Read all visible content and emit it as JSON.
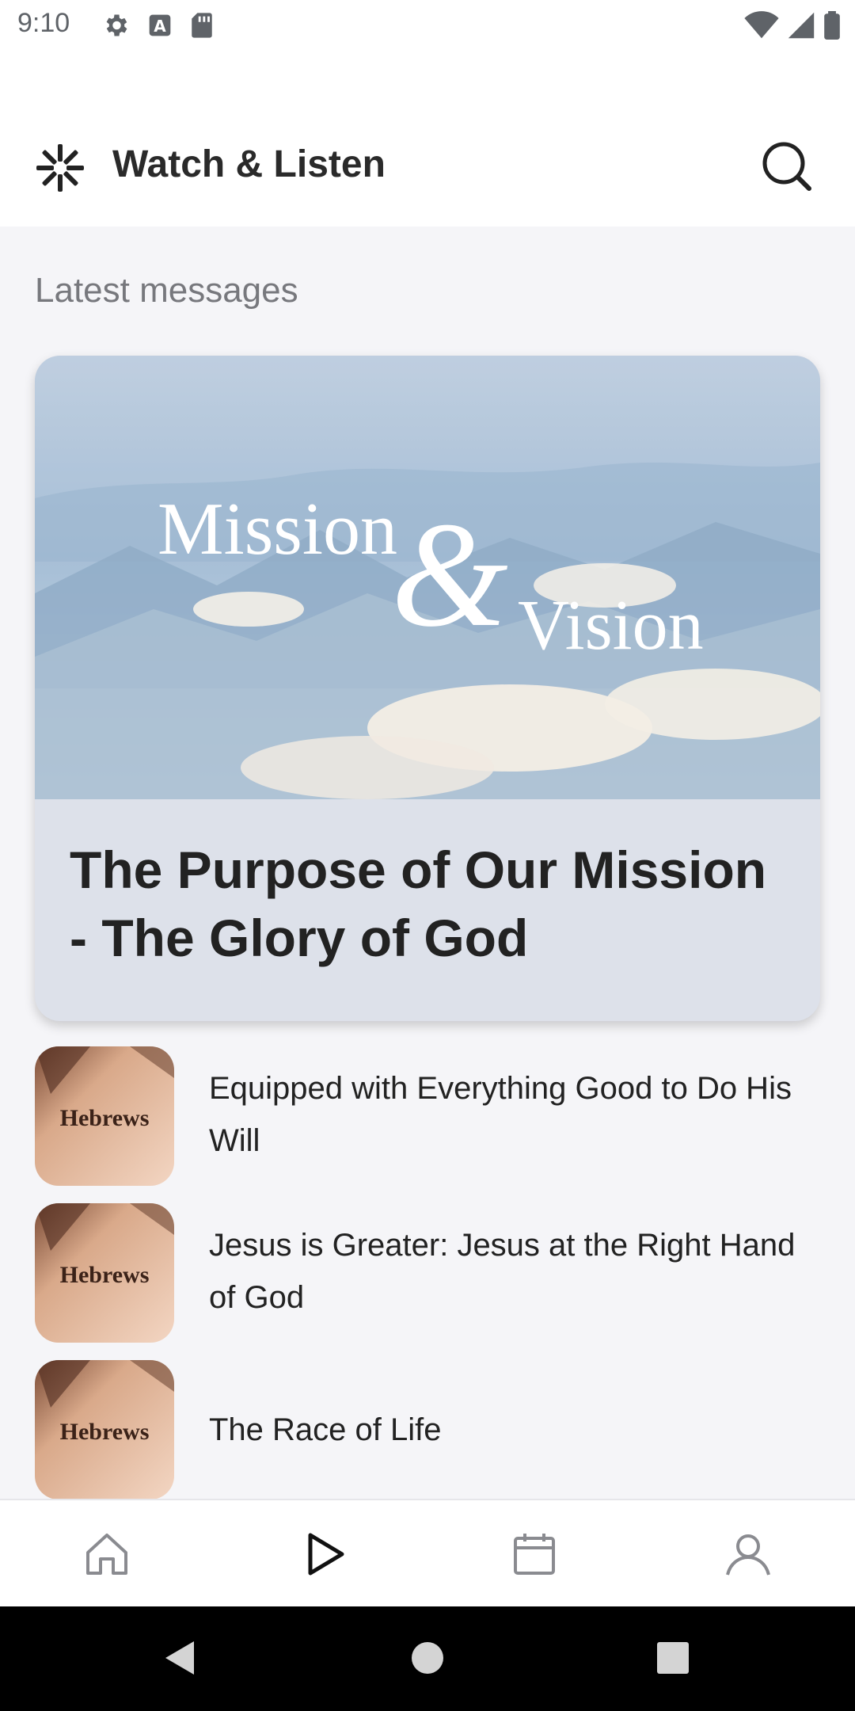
{
  "status_bar": {
    "time": "9:10",
    "icons_left": [
      "gear-icon",
      "font-a-icon",
      "sd-card-icon"
    ],
    "icons_right": [
      "wifi-icon",
      "signal-icon",
      "battery-icon"
    ]
  },
  "header": {
    "title": "Watch & Listen",
    "logo_icon": "asterisk-logo-icon",
    "search_icon": "search-icon"
  },
  "section": {
    "title": "Latest messages"
  },
  "featured": {
    "image_text_1": "Mission",
    "image_text_amp": "&",
    "image_text_2": "Vision",
    "title": "The Purpose of Our Mission - The Glory of God"
  },
  "messages": [
    {
      "title": "Equipped with Everything Good to Do His Will",
      "thumb_label": "Hebrews"
    },
    {
      "title": "Jesus is Greater: Jesus at the Right Hand of God",
      "thumb_label": "Hebrews"
    },
    {
      "title": "The Race of Life",
      "thumb_label": "Hebrews"
    }
  ],
  "bottom_nav": {
    "items": [
      "home-icon",
      "play-icon",
      "calendar-icon",
      "profile-icon"
    ],
    "active": "play-icon"
  },
  "system_nav": {
    "items": [
      "back-icon",
      "home-circle-icon",
      "recents-icon"
    ]
  },
  "colors": {
    "content_bg": "#f5f5f8",
    "card_bg": "#dde1ea",
    "muted_text": "#77787d",
    "nav_icon": "#8a8b90"
  }
}
